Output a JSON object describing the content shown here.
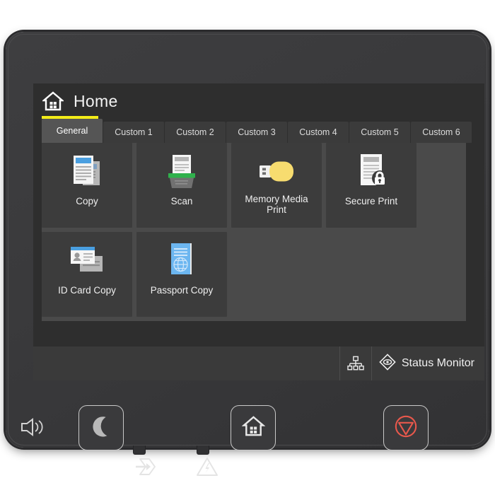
{
  "device": {
    "type": "printer-control-panel"
  },
  "screen": {
    "header": {
      "title": "Home",
      "home_icon": "home-icon",
      "accent_color": "#f3ec18"
    },
    "tabs": [
      {
        "label": "General",
        "active": true
      },
      {
        "label": "Custom 1",
        "active": false
      },
      {
        "label": "Custom 2",
        "active": false
      },
      {
        "label": "Custom 3",
        "active": false
      },
      {
        "label": "Custom 4",
        "active": false
      },
      {
        "label": "Custom 5",
        "active": false
      },
      {
        "label": "Custom 6",
        "active": false
      }
    ],
    "tiles": [
      {
        "label": "Copy",
        "icon": "copy-document-icon",
        "accent": "#4a9fe0"
      },
      {
        "label": "Scan",
        "icon": "scanner-icon",
        "accent": "#27a745"
      },
      {
        "label": "Memory\nMedia Print",
        "icon": "usb-flash-drive-icon",
        "accent": "#f7dc6f"
      },
      {
        "label": "Secure Print",
        "icon": "document-lock-icon",
        "accent": "#bdbdbd"
      },
      {
        "label": "ID Card Copy",
        "icon": "id-card-icon",
        "accent": "#4a9fe0"
      },
      {
        "label": "Passport Copy",
        "icon": "passport-icon",
        "accent": "#6cb6f0"
      }
    ],
    "status_bar": {
      "network_icon": "network-lan-icon",
      "status_monitor_icon": "status-monitor-eye-icon",
      "status_monitor_label": "Status Monitor"
    }
  },
  "hardware_keys": [
    {
      "name": "sleep",
      "icon": "crescent-moon-icon",
      "color": "#b9b9b9"
    },
    {
      "name": "home",
      "icon": "home-icon",
      "color": "#e8e8e8"
    },
    {
      "name": "stop",
      "icon": "stop-icon",
      "color": "#e8584c"
    }
  ],
  "indicators": {
    "speaker_icon": "speaker-volume-icon",
    "data_led_icon": "data-arrow-icon",
    "error_led_icon": "error-warning-icon"
  }
}
